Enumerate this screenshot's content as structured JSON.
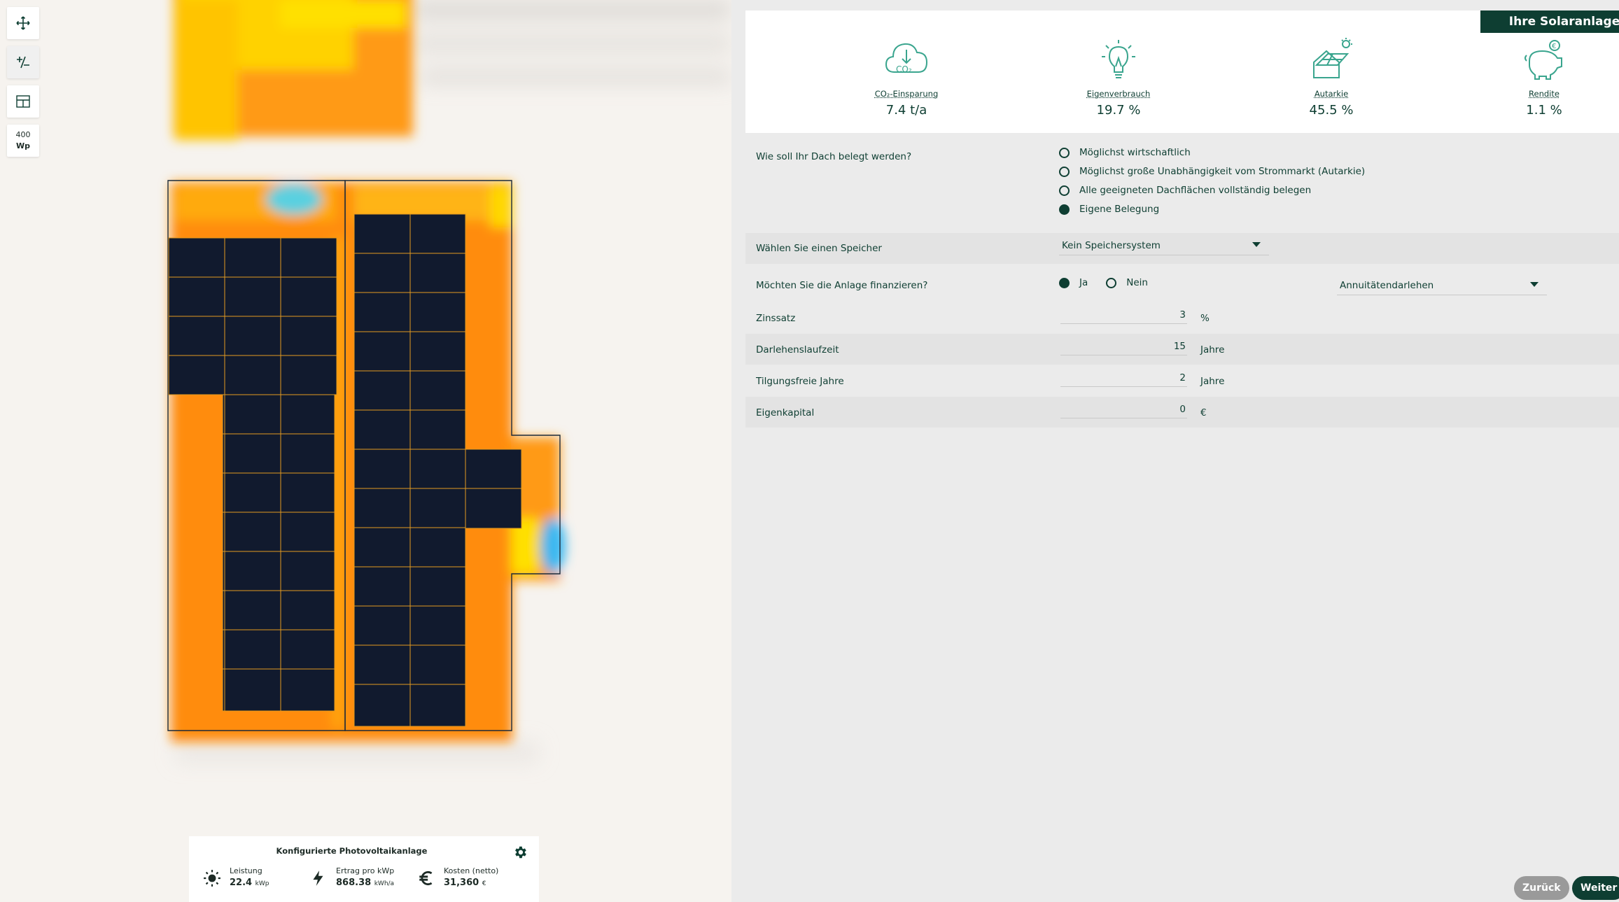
{
  "toolbar": {
    "wp_value": "400",
    "wp_unit": "Wp"
  },
  "summary": {
    "title": "Konfigurierte Photovoltaikanlage",
    "leistung_label": "Leistung",
    "leistung_value": "22.4",
    "leistung_unit": "kWp",
    "ertrag_label": "Ertrag pro kWp",
    "ertrag_value": "868.38",
    "ertrag_unit": "kWh/a",
    "kosten_label": "Kosten (netto)",
    "kosten_value": "31,360",
    "kosten_unit": "€"
  },
  "panel": {
    "tag": "Ihre Solaranlage",
    "kpis": [
      {
        "label": "CO₂-Einsparung",
        "value": "7.4 t/a",
        "icon": "co2-cloud-icon"
      },
      {
        "label": "Eigenverbrauch",
        "value": "19.7 %",
        "icon": "lightbulb-icon"
      },
      {
        "label": "Autarkie",
        "value": "45.5 %",
        "icon": "solar-house-icon"
      },
      {
        "label": "Rendite",
        "value": "1.1 %",
        "icon": "piggy-bank-icon"
      }
    ],
    "roof_question": "Wie soll Ihr Dach belegt werden?",
    "roof_options": [
      "Möglichst wirtschaftlich",
      "Möglichst große Unabhängigkeit vom Strommarkt (Autarkie)",
      "Alle geeigneten Dachflächen vollständig belegen",
      "Eigene Belegung"
    ],
    "roof_selected": 3,
    "storage_label": "Wählen Sie einen Speicher",
    "storage_value": "Kein Speichersystem",
    "finance_label": "Möchten Sie die Anlage finanzieren?",
    "finance_yes": "Ja",
    "finance_no": "Nein",
    "finance_selected": "Ja",
    "loan_type": "Annuitätendarlehen",
    "fields": [
      {
        "label": "Zinssatz",
        "value": "3",
        "unit": "%"
      },
      {
        "label": "Darlehenslaufzeit",
        "value": "15",
        "unit": "Jahre"
      },
      {
        "label": "Tilgungsfreie Jahre",
        "value": "2",
        "unit": "Jahre"
      },
      {
        "label": "Eigenkapital",
        "value": "0",
        "unit": "€"
      }
    ],
    "back_label": "Zurück",
    "next_label": "Weiter"
  },
  "colors": {
    "brand": "#0e3e32",
    "accent": "#3aa58e",
    "heat_orange": "#ff8c1a",
    "panel_module": "#111a2e"
  }
}
